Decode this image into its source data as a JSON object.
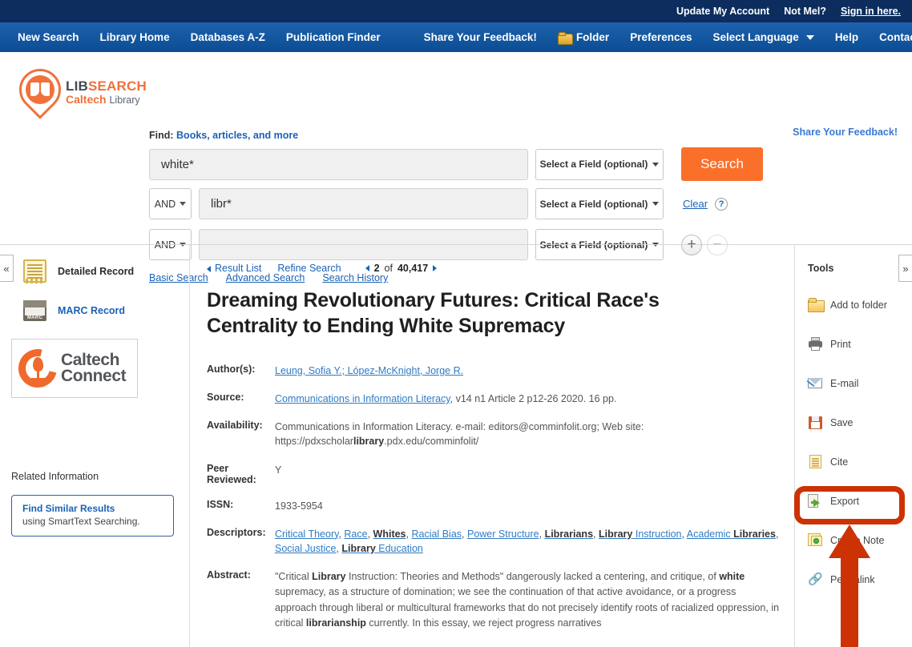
{
  "top_strip": {
    "update_account": "Update My Account",
    "not_user": "Not Mel?",
    "sign_in": "Sign in here."
  },
  "nav": {
    "left_items": [
      "New Search",
      "Library Home",
      "Databases A-Z",
      "Publication Finder"
    ],
    "feedback": "Share Your Feedback!",
    "folder": "Folder",
    "preferences": "Preferences",
    "language": "Select Language",
    "help": "Help",
    "contact": "Contact Us"
  },
  "brand": {
    "line1_a": "LIB",
    "line1_b": "SEARCH",
    "line2_a": "Caltech",
    "line2_b": "Library"
  },
  "search": {
    "find_label_prefix": "Find:",
    "find_label_link": "Books, articles, and more",
    "row1_value": "white*",
    "row1_placeholder": "",
    "row2_bool": "AND",
    "row2_value": "libr*",
    "row3_bool": "AND",
    "row3_value": "",
    "field_select": "Select a Field (optional)",
    "search_button": "Search",
    "clear": "Clear",
    "help_mark": "?",
    "add_row": "+",
    "remove_row": "−",
    "modes": [
      "Basic Search",
      "Advanced Search",
      "Search History"
    ],
    "feedback_right": "Share Your Feedback!"
  },
  "left_panel": {
    "detailed_record": "Detailed Record",
    "marc_record": "MARC Record",
    "caltech_connect_l1": "Caltech",
    "caltech_connect_l2": "Connect",
    "related_information": "Related Information",
    "smart_title": "Find Similar Results",
    "smart_sub": "using SmartText Searching."
  },
  "record": {
    "result_list": "Result List",
    "refine_search": "Refine Search",
    "pager_current": "2",
    "pager_of": "of",
    "pager_total": "40,417",
    "title": "Dreaming Revolutionary Futures: Critical Race's Centrality to Ending White Supremacy",
    "authors_label": "Author(s):",
    "authors": "Leung, Sofia Y.; López-McKnight, Jorge R.",
    "source_label": "Source:",
    "source_link": "Communications in Information Literacy",
    "source_rest": ", v14 n1 Article 2 p12-26 2020. 16 pp.",
    "availability_label": "Availability:",
    "availability_line1": "Communications in Information Literacy. e-mail: editors@comminfolit.org; Web site:",
    "availability_line2_a": "https://pdxscholar",
    "availability_line2_b": "library",
    "availability_line2_c": ".pdx.edu/comminfolit/",
    "peer_label": "Peer Reviewed:",
    "peer_value": "Y",
    "issn_label": "ISSN:",
    "issn_value": "1933-5954",
    "descriptors_label": "Descriptors:",
    "descriptors": [
      "Critical Theory",
      "Race",
      "Whites",
      "Racial Bias",
      "Power Structure",
      "Librarians",
      "Library Instruction",
      "Academic Libraries",
      "Social Justice",
      "Library Education"
    ],
    "abstract_label": "Abstract:",
    "abstract": "\"Critical Library Instruction: Theories and Methods\" dangerously lacked a centering, and critique, of white supremacy, as a structure of domination; we see the continuation of that active avoidance, or a progress approach through liberal or multicultural frameworks that do not precisely identify roots of racialized oppression, in critical librarianship currently. In this essay, we reject progress narratives"
  },
  "tools": {
    "header": "Tools",
    "items": [
      {
        "label": "Add to folder",
        "icon": "folder-icon"
      },
      {
        "label": "Print",
        "icon": "printer-icon"
      },
      {
        "label": "E-mail",
        "icon": "envelope-icon"
      },
      {
        "label": "Save",
        "icon": "floppy-disk-icon"
      },
      {
        "label": "Cite",
        "icon": "document-icon"
      },
      {
        "label": "Export",
        "icon": "export-icon"
      },
      {
        "label": "Create Note",
        "icon": "sticky-note-icon"
      },
      {
        "label": "Permalink",
        "icon": "link-icon"
      }
    ]
  },
  "annotation": {
    "color": "#cc3204",
    "target": "Create Note"
  },
  "colors": {
    "top_strip": "#0c2d5e",
    "nav_bar": "#1558a1",
    "accent_orange": "#fa702b",
    "link_blue": "#1a62b5",
    "brand_orange": "#f0713a"
  }
}
